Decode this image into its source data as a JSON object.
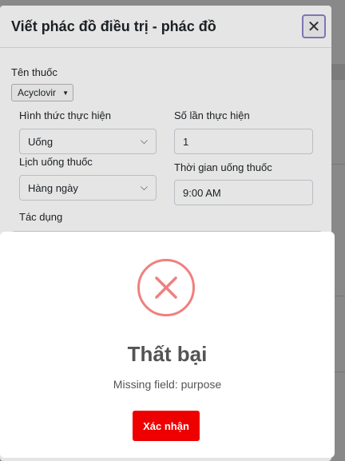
{
  "modal": {
    "title": "Viết phác đồ điều trị - phác đồ",
    "close_label": "✕",
    "drug_label": "Tên thuốc",
    "drug_value": "Acyclovir",
    "method_label": "Hình thức thực hiện",
    "method_value": "Uống",
    "count_label": "Số lần thực hiện",
    "count_value": "1",
    "schedule_label": "Lịch uống thuốc",
    "schedule_value": "Hàng ngày",
    "time_label": "Thời gian uống thuốc",
    "time_value": "9:00 AM",
    "purpose_label": "Tác dụng"
  },
  "alert": {
    "title": "Thất bại",
    "message": "Missing field: purpose",
    "confirm_label": "Xác nhận"
  },
  "colors": {
    "error_red": "#f08080",
    "confirm_button": "#ee0000",
    "close_focus": "#8b84c9"
  },
  "icons": [
    "error-x-icon",
    "close-icon",
    "chevron-down-icon",
    "caret-down-icon"
  ]
}
